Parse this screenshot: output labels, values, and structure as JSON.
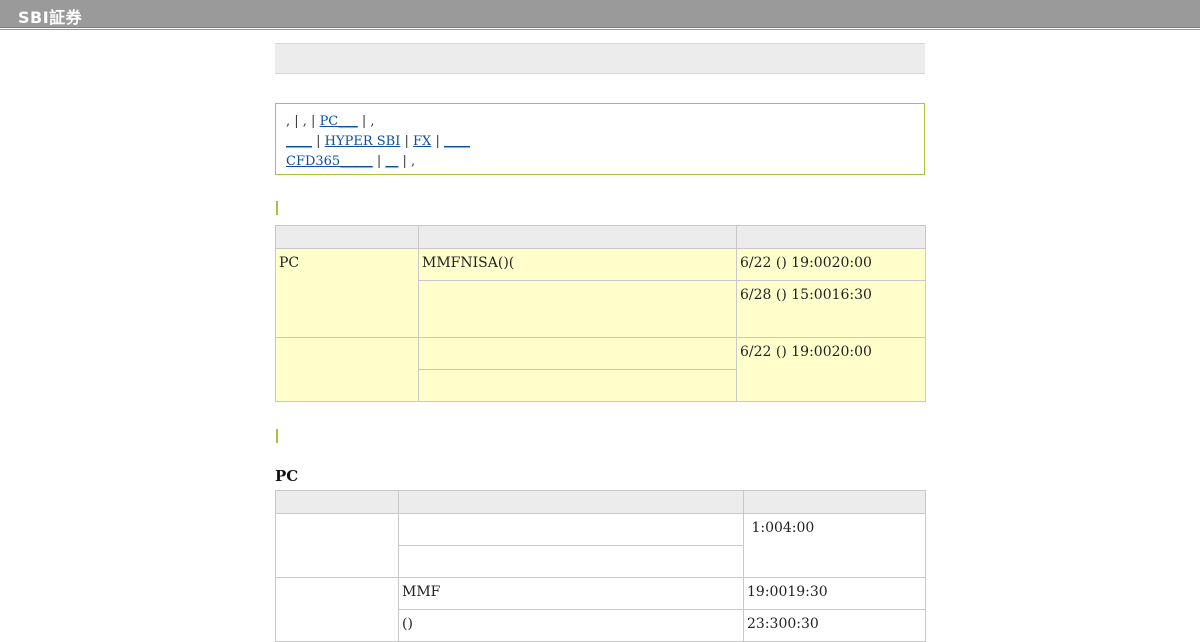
{
  "header": {
    "logo": "SBI証券"
  },
  "notice": {
    "line1_prefix": ", | , |",
    "link_pc": "PC___",
    "line1_suffix": "| ,",
    "link_blank1": "____",
    "sep1": "|",
    "link_hyper_sbi": "HYPER SBI",
    "sep2": "|",
    "link_fx": "FX",
    "sep3": "|",
    "link_blank2": "____",
    "link_cfd": "CFD365_____",
    "sep4": "|",
    "link_blank3": "__",
    "line3_suffix": "| ,"
  },
  "table1": {
    "rows": [
      {
        "col1": "PC",
        "col2": "MMFNISA()(",
        "col3": "6/22 () 19:0020:00"
      },
      {
        "col2": "",
        "col3": "6/28 () 15:0016:30"
      },
      {
        "col1": "",
        "col2": "",
        "col3": "6/22 () 19:0020:00"
      },
      {
        "col2": ""
      }
    ]
  },
  "section2": {
    "title": "PC"
  },
  "table2": {
    "rows": [
      {
        "col1": "",
        "col2": "",
        "col3": " 1:004:00"
      },
      {
        "col2": ""
      },
      {
        "col1": "",
        "col2": "MMF",
        "col3": "19:0019:30"
      },
      {
        "col2": "()",
        "col3": "23:300:30"
      }
    ]
  },
  "colors": {
    "accent": "#a7c43a",
    "highlight": "#ffffcc",
    "link": "#0a4f9a"
  }
}
